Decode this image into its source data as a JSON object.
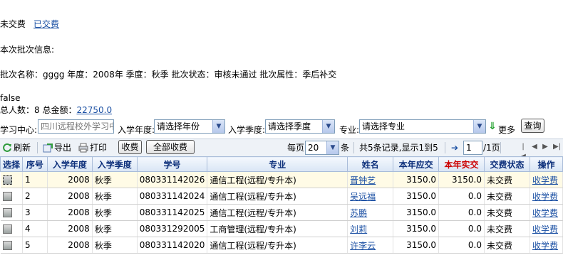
{
  "tabs": {
    "unpaid": "未交费",
    "paid": "已交费"
  },
  "batch": {
    "section_title": "本次批次信息:",
    "info_line": "批次名称：gggg  年度：2008年    季度：秋季    批次状态：审核未通过    批次属性：季后补交",
    "flag": "false",
    "total_people_label": "总人数：8   总金额：",
    "total_amount": "22750.0"
  },
  "filters": {
    "center_label": "学习中心:",
    "center_value": "四川远程校外学习中",
    "year_label": "入学年度:",
    "year_value": "请选择年份",
    "season_label": "入学季度:",
    "season_value": "请选择季度",
    "major_label": "专业:",
    "major_value": "请选择专业",
    "more_label": "更多",
    "query_label": "查询"
  },
  "toolbar": {
    "refresh": "刷新",
    "export": "导出",
    "print": "打印",
    "charge": "收费",
    "charge_all": "全部收费",
    "per_page_label": "每页",
    "per_page_value": "20",
    "per_page_unit": "条",
    "records_info": "共5条记录,显示1到5",
    "page_value": "1",
    "page_total": "/1页"
  },
  "table": {
    "headers": [
      "选择",
      "序号",
      "入学年度",
      "入学季度",
      "学号",
      "专业",
      "姓名",
      "本年应交",
      "本年实交",
      "交费状态",
      "操作"
    ],
    "rows": [
      {
        "no": "1",
        "year": "2008",
        "season": "秋季",
        "sid": "080331142026",
        "major": "通信工程(远程/专升本)",
        "name": "晋钟艺",
        "due": "3150.0",
        "paid": "3150.0",
        "status": "未交费",
        "op": "收学费"
      },
      {
        "no": "2",
        "year": "2008",
        "season": "秋季",
        "sid": "080331142024",
        "major": "通信工程(远程/专升本)",
        "name": "吴远福",
        "due": "3150.0",
        "paid": "0.0",
        "status": "未交费",
        "op": "收学费"
      },
      {
        "no": "3",
        "year": "2008",
        "season": "秋季",
        "sid": "080331142025",
        "major": "通信工程(远程/专升本)",
        "name": "苏鹏",
        "due": "3150.0",
        "paid": "0.0",
        "status": "未交费",
        "op": "收学费"
      },
      {
        "no": "4",
        "year": "2008",
        "season": "秋季",
        "sid": "080331292005",
        "major": "工商管理(远程/专升本)",
        "name": "刘莉",
        "due": "3150.0",
        "paid": "0.0",
        "status": "未交费",
        "op": "收学费"
      },
      {
        "no": "5",
        "year": "2008",
        "season": "秋季",
        "sid": "080331142020",
        "major": "通信工程(远程/专升本)",
        "name": "许李云",
        "due": "3150.0",
        "paid": "0.0",
        "status": "未交费",
        "op": "收学费"
      }
    ]
  },
  "colors": {
    "link": "#1a4fa3",
    "header_text": "#0b2e7a",
    "header_red": "#cc0000",
    "first_row_bg": "#fffbe6"
  }
}
